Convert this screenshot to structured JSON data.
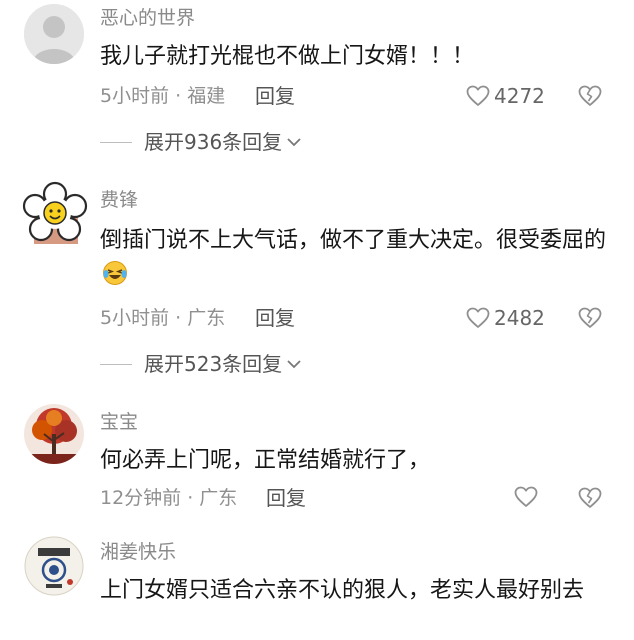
{
  "comments": [
    {
      "username": "恶心的世界",
      "text": "我儿子就打光棍也不做上门女婿！！！",
      "meta": "5小时前 · 福建",
      "reply_label": "回复",
      "likes": "4272",
      "expand_label": "展开936条回复"
    },
    {
      "username": "费锋",
      "text": "倒插门说不上大气话，做不了重大决定。很受委屈的",
      "meta": "5小时前 · 广东",
      "reply_label": "回复",
      "likes": "2482",
      "expand_label": "展开523条回复"
    },
    {
      "username": "宝宝",
      "text": "何必弄上门呢，正常结婚就行了，",
      "meta": "12分钟前 · 广东",
      "reply_label": "回复",
      "likes": ""
    },
    {
      "username": "湘姜快乐",
      "text": "上门女婿只适合六亲不认的狠人，老实人最好别去"
    }
  ],
  "colors": {
    "text": "#161616",
    "secondary": "#8a8a8a",
    "icon": "#999999"
  }
}
